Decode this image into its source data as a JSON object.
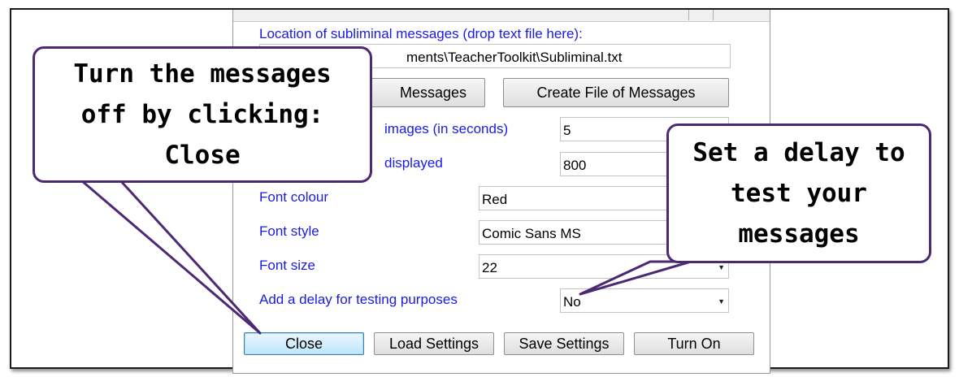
{
  "form": {
    "location_label": "Location of subliminal messages (drop text file here):",
    "location_value": "C:\\Users\\Documents\\TeacherToolkit\\Subliminal.txt",
    "location_value_visible": "ments\\TeacherToolkit\\Subliminal.txt",
    "load_messages_label": "Messages",
    "create_file_label": "Create File of Messages",
    "interval_label": "images (in seconds)",
    "interval_value": "5",
    "duration_label": "displayed",
    "duration_value": "800",
    "font_colour_label": "Font colour",
    "font_colour_value": "Red",
    "font_style_label": "Font style",
    "font_style_value": "Comic Sans MS",
    "font_size_label": "Font size",
    "font_size_value": "22",
    "delay_label": "Add a delay for testing purposes",
    "delay_value": "No"
  },
  "buttons": {
    "close": "Close",
    "load_settings": "Load Settings",
    "save_settings": "Save Settings",
    "turn_on": "Turn On"
  },
  "callouts": {
    "left": [
      "Turn the messages",
      "off by clicking:",
      "Close"
    ],
    "right": [
      "Set a delay to",
      "test your",
      "messages"
    ]
  },
  "colors": {
    "label_blue": "#1a1ae6",
    "callout_border": "#4b2a73"
  }
}
